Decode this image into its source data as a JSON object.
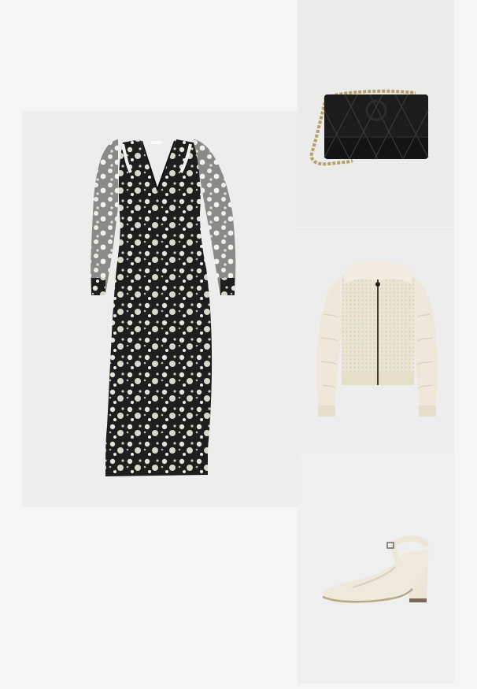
{
  "outfit": {
    "items": [
      {
        "id": "dress",
        "name": "floral-maxi-dress"
      },
      {
        "id": "bag",
        "name": "quilted-chain-shoulder-bag"
      },
      {
        "id": "jacket",
        "name": "knit-zip-cardigan"
      },
      {
        "id": "shoe",
        "name": "block-heel-slingback-pump"
      }
    ],
    "colors": {
      "background": "#f5f5f5",
      "tile": "#efefef",
      "dress_base": "#1d1d1d",
      "dress_print": "#e8e6de",
      "bag": "#141414",
      "chain": "#b9a06a",
      "cream": "#efe9dc"
    }
  }
}
